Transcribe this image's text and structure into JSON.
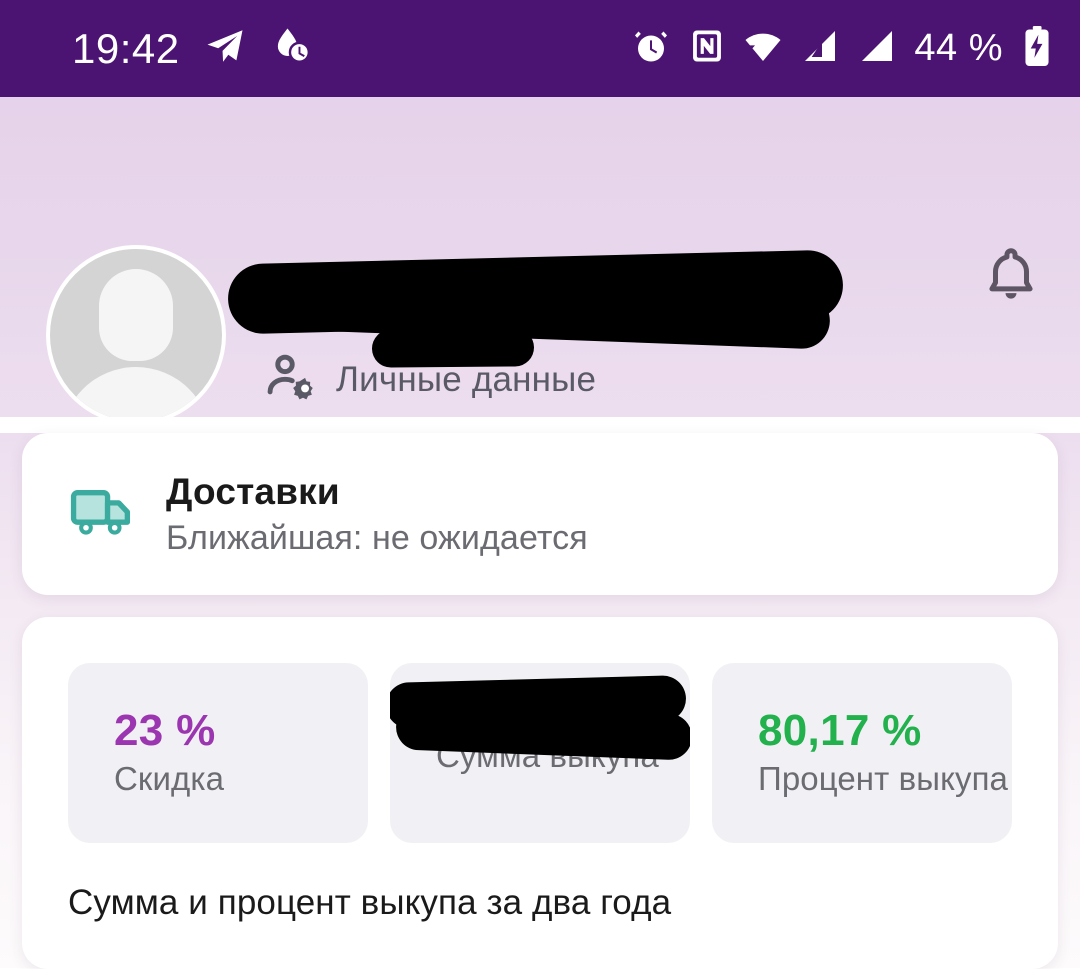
{
  "status_bar": {
    "time": "19:42",
    "battery_percent": "44 %",
    "left_icons": [
      {
        "name": "telegram-icon"
      },
      {
        "name": "water-drop-timer-icon"
      }
    ],
    "right_icons": [
      {
        "name": "alarm-clock-icon"
      },
      {
        "name": "nfc-icon"
      },
      {
        "name": "wifi-icon"
      },
      {
        "name": "signal-sim1-icon"
      },
      {
        "name": "signal-sim2-icon"
      },
      {
        "name": "battery-charging-icon"
      }
    ],
    "background_color": "#4c1472"
  },
  "header": {
    "avatar_name": "avatar-placeholder",
    "user_name_redacted": "",
    "personal_data_label": "Личные данные",
    "personal_data_icon": "person-settings-icon",
    "notifications_icon": "bell-icon",
    "background_color": "#e8d7ec"
  },
  "delivery_card": {
    "icon": "truck-icon",
    "icon_color": "#3aab9e",
    "title": "Доставки",
    "subtitle": "Ближайшая: не ожидается"
  },
  "stats_card": {
    "tiles": [
      {
        "value": "23 %",
        "label": "Скидка",
        "color": "#9b36b0",
        "redacted": false
      },
      {
        "value": "",
        "label": "Сумма выкупа",
        "color": "#1a1a1a",
        "redacted": true
      },
      {
        "value": "80,17 %",
        "label": "Процент выкупа",
        "color": "#22b14c",
        "redacted": false
      }
    ],
    "caption": "Сумма и процент выкупа за два года"
  }
}
